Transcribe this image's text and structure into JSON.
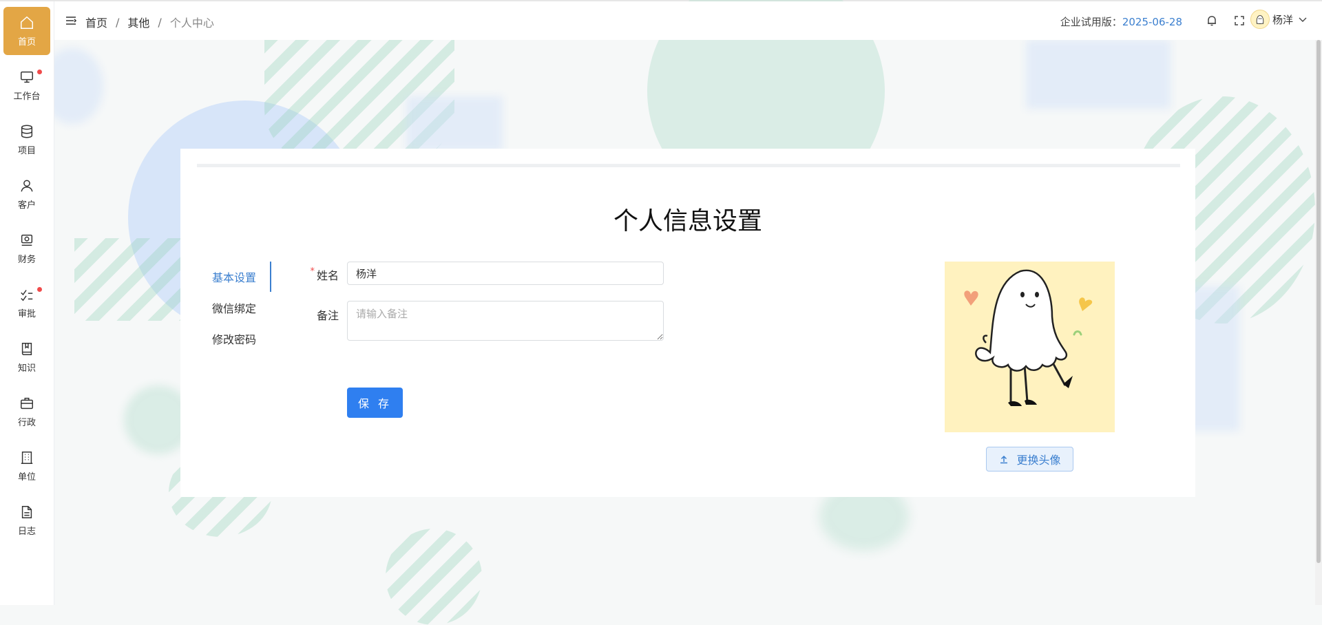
{
  "sidebar": {
    "items": [
      {
        "label": "首页",
        "icon": "home-icon",
        "active": true
      },
      {
        "label": "工作台",
        "icon": "monitor-icon",
        "badge": true
      },
      {
        "label": "项目",
        "icon": "database-icon"
      },
      {
        "label": "客户",
        "icon": "user-icon"
      },
      {
        "label": "财务",
        "icon": "money-icon"
      },
      {
        "label": "审批",
        "icon": "approval-icon",
        "badge": true
      },
      {
        "label": "知识",
        "icon": "book-icon"
      },
      {
        "label": "行政",
        "icon": "briefcase-icon"
      },
      {
        "label": "单位",
        "icon": "building-icon"
      },
      {
        "label": "日志",
        "icon": "document-icon"
      }
    ]
  },
  "header": {
    "breadcrumb": [
      "首页",
      "其他",
      "个人中心"
    ],
    "separator": "/",
    "trial_label": "企业试用版：",
    "trial_date": "2025-06-28",
    "user_name": "杨洋"
  },
  "main": {
    "title": "个人信息设置",
    "tabs": [
      {
        "label": "基本设置",
        "active": true
      },
      {
        "label": "微信绑定"
      },
      {
        "label": "修改密码"
      }
    ],
    "form": {
      "name_label": "姓名",
      "name_required_mark": "*",
      "name_value": "杨洋",
      "note_label": "备注",
      "note_placeholder": "请输入备注",
      "save_label": "保 存"
    },
    "upload_label": "更换头像"
  },
  "colors": {
    "active_nav": "#e3a645",
    "primary": "#2f7ff0",
    "link": "#3b7fcf",
    "badge": "#f04b4b"
  }
}
